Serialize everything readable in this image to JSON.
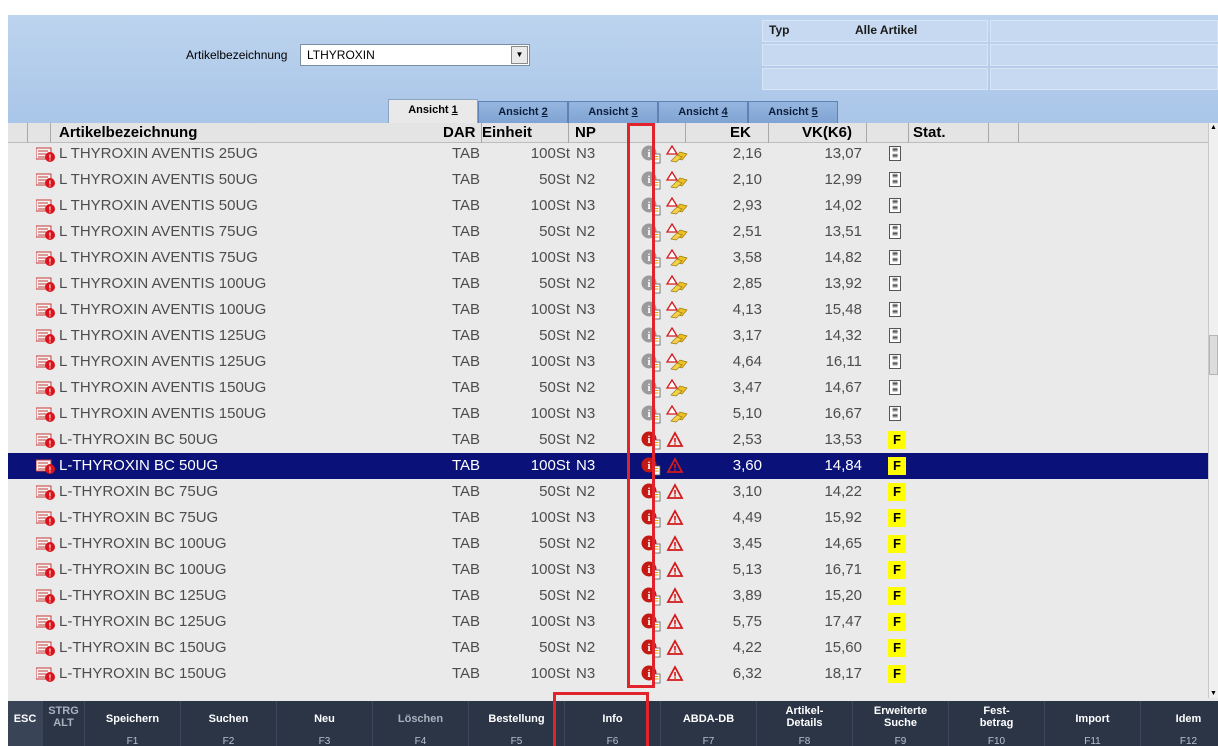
{
  "filter": {
    "label": "Artikelbezeichnung",
    "value": "LTHYROXIN",
    "dropdown_icon": "chevron-down-icon"
  },
  "typ_panel": {
    "typ_label": "Typ",
    "typ_value": "Alle Artikel"
  },
  "tabs": [
    {
      "label": "Ansicht ",
      "key": "1",
      "active": true
    },
    {
      "label": "Ansicht ",
      "key": "2",
      "active": false
    },
    {
      "label": "Ansicht ",
      "key": "3",
      "active": false
    },
    {
      "label": "Ansicht ",
      "key": "4",
      "active": false
    },
    {
      "label": "Ansicht ",
      "key": "5",
      "active": false
    }
  ],
  "columns": {
    "name": "Artikelbezeichnung",
    "dar": "DAR",
    "einheit": "Einheit",
    "np": "NP",
    "ek": "EK",
    "vk": "VK(K6)",
    "stat": "Stat."
  },
  "rows": [
    {
      "name": "L THYROXIN AVENTIS 25UG",
      "dar": "TAB",
      "einheit": "100St",
      "np": "N3",
      "ek": "2,16",
      "vk": "13,07",
      "info": "grey",
      "warn": "aventis",
      "badge": "s"
    },
    {
      "name": "L THYROXIN AVENTIS 50UG",
      "dar": "TAB",
      "einheit": "50St",
      "np": "N2",
      "ek": "2,10",
      "vk": "12,99",
      "info": "grey",
      "warn": "aventis",
      "badge": "s"
    },
    {
      "name": "L THYROXIN AVENTIS 50UG",
      "dar": "TAB",
      "einheit": "100St",
      "np": "N3",
      "ek": "2,93",
      "vk": "14,02",
      "info": "grey",
      "warn": "aventis",
      "badge": "s"
    },
    {
      "name": "L THYROXIN AVENTIS 75UG",
      "dar": "TAB",
      "einheit": "50St",
      "np": "N2",
      "ek": "2,51",
      "vk": "13,51",
      "info": "grey",
      "warn": "aventis",
      "badge": "s"
    },
    {
      "name": "L THYROXIN AVENTIS 75UG",
      "dar": "TAB",
      "einheit": "100St",
      "np": "N3",
      "ek": "3,58",
      "vk": "14,82",
      "info": "grey",
      "warn": "aventis",
      "badge": "s"
    },
    {
      "name": "L THYROXIN AVENTIS 100UG",
      "dar": "TAB",
      "einheit": "50St",
      "np": "N2",
      "ek": "2,85",
      "vk": "13,92",
      "info": "grey",
      "warn": "aventis",
      "badge": "s"
    },
    {
      "name": "L THYROXIN AVENTIS 100UG",
      "dar": "TAB",
      "einheit": "100St",
      "np": "N3",
      "ek": "4,13",
      "vk": "15,48",
      "info": "grey",
      "warn": "aventis",
      "badge": "s"
    },
    {
      "name": "L THYROXIN AVENTIS 125UG",
      "dar": "TAB",
      "einheit": "50St",
      "np": "N2",
      "ek": "3,17",
      "vk": "14,32",
      "info": "grey",
      "warn": "aventis",
      "badge": "s"
    },
    {
      "name": "L THYROXIN AVENTIS 125UG",
      "dar": "TAB",
      "einheit": "100St",
      "np": "N3",
      "ek": "4,64",
      "vk": "16,11",
      "info": "grey",
      "warn": "aventis",
      "badge": "s"
    },
    {
      "name": "L THYROXIN AVENTIS 150UG",
      "dar": "TAB",
      "einheit": "50St",
      "np": "N2",
      "ek": "3,47",
      "vk": "14,67",
      "info": "grey",
      "warn": "aventis",
      "badge": "s"
    },
    {
      "name": "L THYROXIN AVENTIS 150UG",
      "dar": "TAB",
      "einheit": "100St",
      "np": "N3",
      "ek": "5,10",
      "vk": "16,67",
      "info": "grey",
      "warn": "aventis",
      "badge": "s"
    },
    {
      "name": "L-THYROXIN BC 50UG",
      "dar": "TAB",
      "einheit": "50St",
      "np": "N2",
      "ek": "2,53",
      "vk": "13,53",
      "info": "red",
      "warn": "red",
      "badge": "F"
    },
    {
      "name": "L-THYROXIN BC 50UG",
      "dar": "TAB",
      "einheit": "100St",
      "np": "N3",
      "ek": "3,60",
      "vk": "14,84",
      "info": "red",
      "warn": "red",
      "badge": "F",
      "selected": true
    },
    {
      "name": "L-THYROXIN BC 75UG",
      "dar": "TAB",
      "einheit": "50St",
      "np": "N2",
      "ek": "3,10",
      "vk": "14,22",
      "info": "red",
      "warn": "red",
      "badge": "F"
    },
    {
      "name": "L-THYROXIN BC 75UG",
      "dar": "TAB",
      "einheit": "100St",
      "np": "N3",
      "ek": "4,49",
      "vk": "15,92",
      "info": "red",
      "warn": "red",
      "badge": "F"
    },
    {
      "name": "L-THYROXIN BC 100UG",
      "dar": "TAB",
      "einheit": "50St",
      "np": "N2",
      "ek": "3,45",
      "vk": "14,65",
      "info": "red",
      "warn": "red",
      "badge": "F"
    },
    {
      "name": "L-THYROXIN BC 100UG",
      "dar": "TAB",
      "einheit": "100St",
      "np": "N3",
      "ek": "5,13",
      "vk": "16,71",
      "info": "red",
      "warn": "red",
      "badge": "F"
    },
    {
      "name": "L-THYROXIN BC 125UG",
      "dar": "TAB",
      "einheit": "50St",
      "np": "N2",
      "ek": "3,89",
      "vk": "15,20",
      "info": "red",
      "warn": "red",
      "badge": "F"
    },
    {
      "name": "L-THYROXIN BC 125UG",
      "dar": "TAB",
      "einheit": "100St",
      "np": "N3",
      "ek": "5,75",
      "vk": "17,47",
      "info": "red",
      "warn": "red",
      "badge": "F"
    },
    {
      "name": "L-THYROXIN BC 150UG",
      "dar": "TAB",
      "einheit": "50St",
      "np": "N2",
      "ek": "4,22",
      "vk": "15,60",
      "info": "red",
      "warn": "red",
      "badge": "F"
    },
    {
      "name": "L-THYROXIN BC 150UG",
      "dar": "TAB",
      "einheit": "100St",
      "np": "N3",
      "ek": "6,32",
      "vk": "18,17",
      "info": "red",
      "warn": "red",
      "badge": "F"
    }
  ],
  "fkeys": [
    {
      "label": "ESC",
      "code": "",
      "enabled": true,
      "w": 34
    },
    {
      "label": "STRG\nALT",
      "code": "",
      "enabled": false,
      "w": 42
    },
    {
      "label": "Speichern",
      "code": "F1",
      "enabled": true,
      "w": 96
    },
    {
      "label": "Suchen",
      "code": "F2",
      "enabled": true,
      "w": 96
    },
    {
      "label": "Neu",
      "code": "F3",
      "enabled": true,
      "w": 96
    },
    {
      "label": "Löschen",
      "code": "F4",
      "enabled": false,
      "w": 96
    },
    {
      "label": "Bestellung",
      "code": "F5",
      "enabled": true,
      "w": 96
    },
    {
      "label": "Info",
      "code": "F6",
      "enabled": true,
      "w": 96
    },
    {
      "label": "ABDA-DB",
      "code": "F7",
      "enabled": true,
      "w": 96
    },
    {
      "label": "Artikel-\nDetails",
      "code": "F8",
      "enabled": true,
      "w": 96
    },
    {
      "label": "Erweiterte\nSuche",
      "code": "F9",
      "enabled": true,
      "w": 96
    },
    {
      "label": "Fest-\nbetrag",
      "code": "F10",
      "enabled": true,
      "w": 96
    },
    {
      "label": "Import",
      "code": "F11",
      "enabled": true,
      "w": 96
    },
    {
      "label": "Idem",
      "code": "F12",
      "enabled": true,
      "w": 96
    }
  ],
  "colors": {
    "selection": "#0a1178",
    "highlight": "#e1242c",
    "badge_yellow": "#ffff00",
    "fbar": "#2b3546"
  }
}
